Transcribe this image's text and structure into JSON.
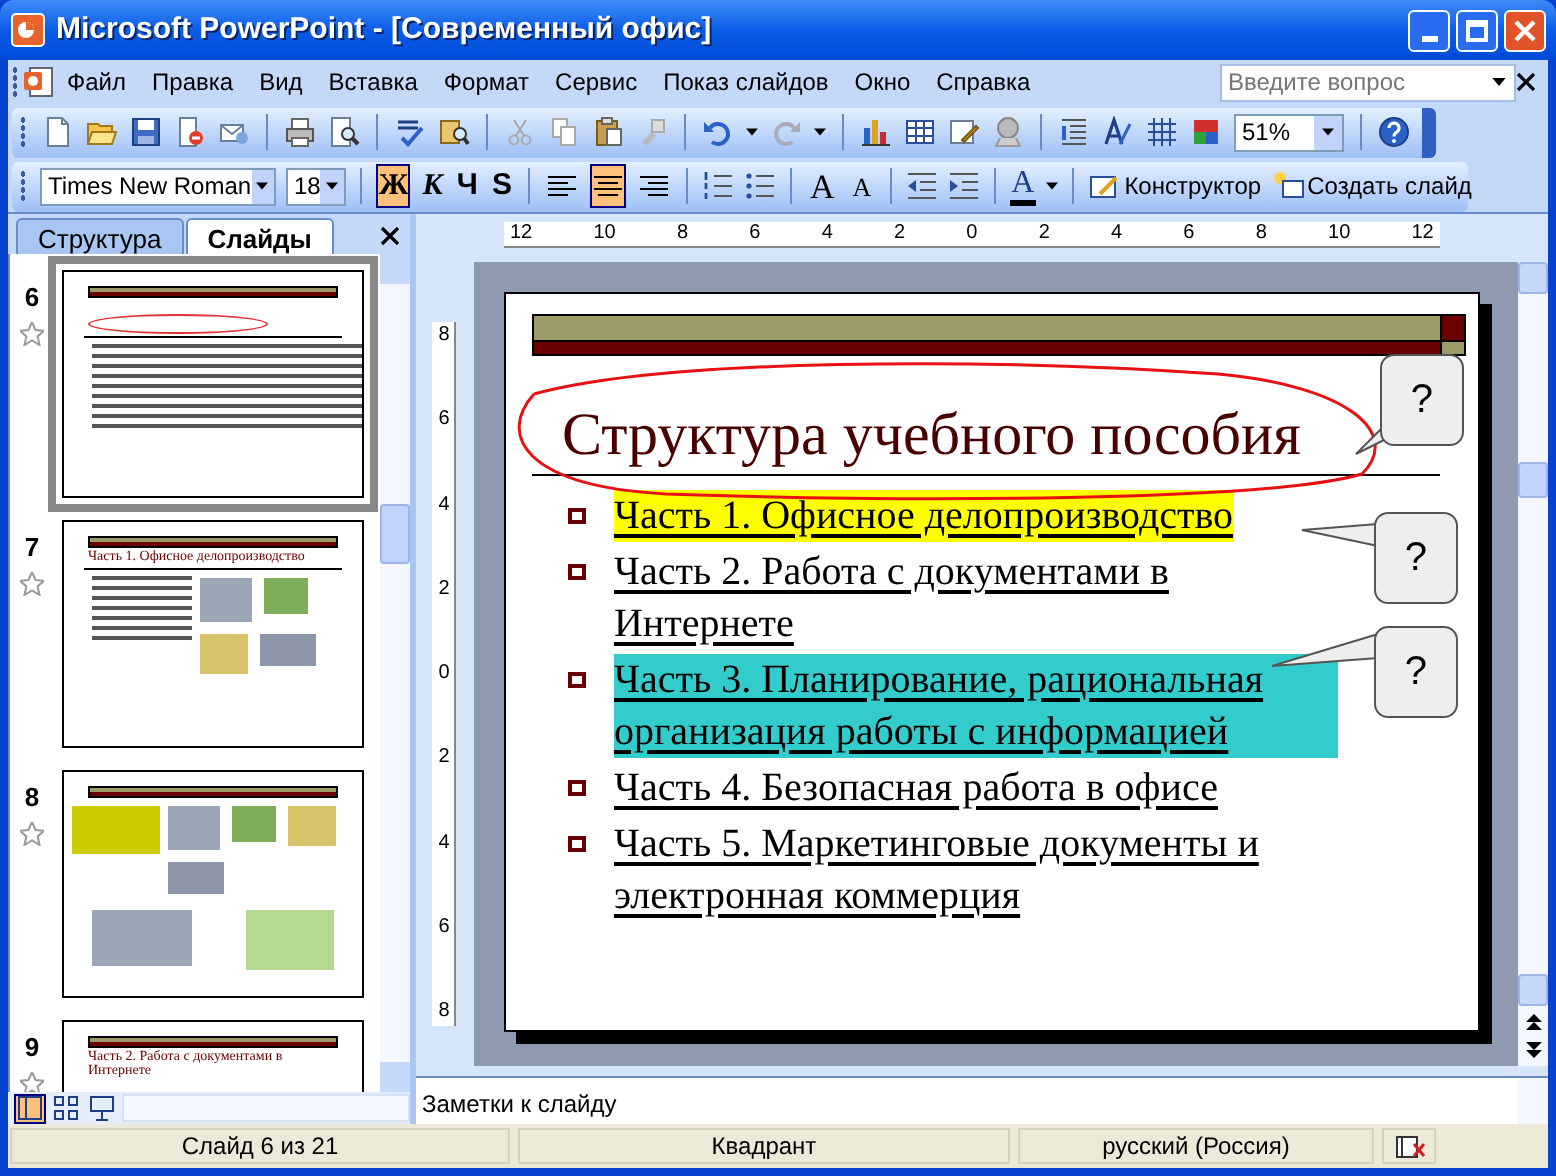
{
  "window": {
    "title": "Microsoft PowerPoint - [Современный офис]"
  },
  "menu": {
    "items": [
      "Файл",
      "Правка",
      "Вид",
      "Вставка",
      "Формат",
      "Сервис",
      "Показ слайдов",
      "Окно",
      "Справка"
    ],
    "help_search": {
      "placeholder": "Введите вопрос"
    }
  },
  "standard_toolbar": {
    "zoom": "51%"
  },
  "formatting_toolbar": {
    "font": "Times New Roman",
    "size": "18",
    "style_buttons": [
      {
        "label": "Ж",
        "selected": true
      },
      {
        "label": "К",
        "selected": false
      },
      {
        "label": "Ч",
        "selected": false
      },
      {
        "label": "S",
        "selected": false
      }
    ],
    "align_buttons": [
      {
        "kind": "left",
        "selected": false
      },
      {
        "kind": "center",
        "selected": true
      },
      {
        "kind": "right",
        "selected": false
      }
    ],
    "grow_font": "A",
    "shrink_font": "A",
    "font_color": "A",
    "design_button": "Конструктор",
    "new_slide_button": "Создать слайд"
  },
  "pane_tabs": [
    {
      "label": "Структура",
      "selected": false
    },
    {
      "label": "Слайды",
      "selected": true
    }
  ],
  "thumbnails": [
    {
      "number": "6",
      "selected": true,
      "kind": "bullets"
    },
    {
      "number": "7",
      "selected": false,
      "kind": "bullets_clipart",
      "title": "Часть 1. Офисное делопроизводство"
    },
    {
      "number": "8",
      "selected": false,
      "kind": "clipart"
    },
    {
      "number": "9",
      "selected": false,
      "kind": "title",
      "title": "Часть 2. Работа с документами в Интернете"
    }
  ],
  "view_buttons": [
    {
      "kind": "normal",
      "selected": true
    },
    {
      "kind": "sorter",
      "selected": false
    },
    {
      "kind": "show",
      "selected": false
    }
  ],
  "ruler": {
    "horizontal": [
      "12",
      "10",
      "8",
      "6",
      "4",
      "2",
      "0",
      "2",
      "4",
      "6",
      "8",
      "10",
      "12"
    ],
    "vertical": [
      "8",
      "6",
      "4",
      "2",
      "0",
      "2",
      "4",
      "6",
      "8"
    ]
  },
  "slide": {
    "title": "Структура учебного пособия",
    "bullets": [
      {
        "text": "Часть 1. Офисное делопроизводство",
        "color": "#ffff00"
      },
      {
        "text": "Часть 2. Работа с документами в Интернете"
      },
      {
        "text": "Часть 3. Планирование, рациональная организация работы с информацией",
        "color": "#33cccc"
      },
      {
        "text": "Часть 4. Безопасная работа в офисе"
      },
      {
        "text": "Часть 5. Маркетинговые документы и электронная коммерция"
      }
    ],
    "callouts": [
      "?",
      "?",
      "?"
    ]
  },
  "notes": {
    "placeholder": "Заметки к слайду"
  },
  "status_bar": [
    "Слайд 6 из 21",
    "Квадрант",
    "русский (Россия)"
  ]
}
